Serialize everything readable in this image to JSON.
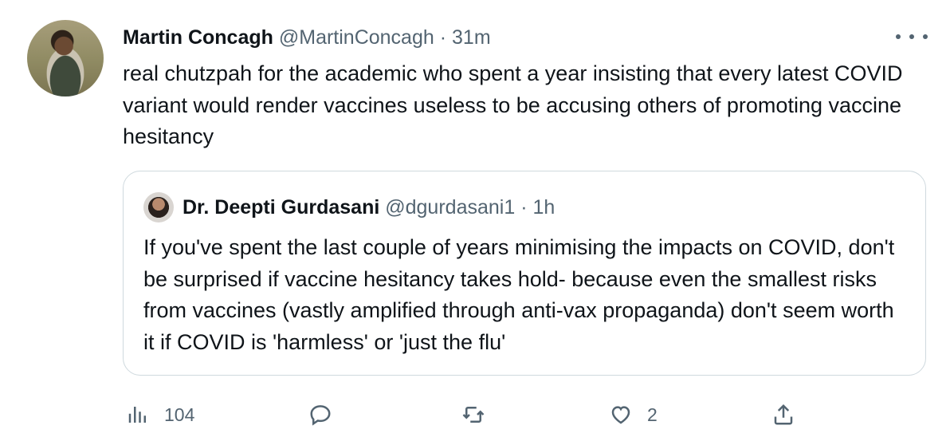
{
  "tweet": {
    "author_name": "Martin Concagh",
    "author_handle": "@MartinConcagh",
    "separator": "·",
    "time": "31m",
    "text": "real chutzpah for the academic who spent a year insisting that every latest COVID variant would render vaccines useless to be accusing others of promoting vaccine hesitancy"
  },
  "quoted_tweet": {
    "author_name": "Dr. Deepti Gurdasani",
    "author_handle": "@dgurdasani1",
    "separator": "·",
    "time": "1h",
    "text": "If you've spent the last couple of years minimising the impacts on COVID, don't be surprised if vaccine hesitancy takes hold- because even the smallest risks from vaccines (vastly amplified through anti-vax propaganda) don't seem worth it if COVID is 'harmless' or 'just the flu'"
  },
  "actions": {
    "views_icon": "analytics-icon",
    "views_count": "104",
    "reply_icon": "reply-icon",
    "retweet_icon": "retweet-icon",
    "like_icon": "heart-icon",
    "like_count": "2",
    "share_icon": "share-icon"
  },
  "colors": {
    "text": "#0f1419",
    "muted": "#536471",
    "border": "#cfd9de"
  }
}
